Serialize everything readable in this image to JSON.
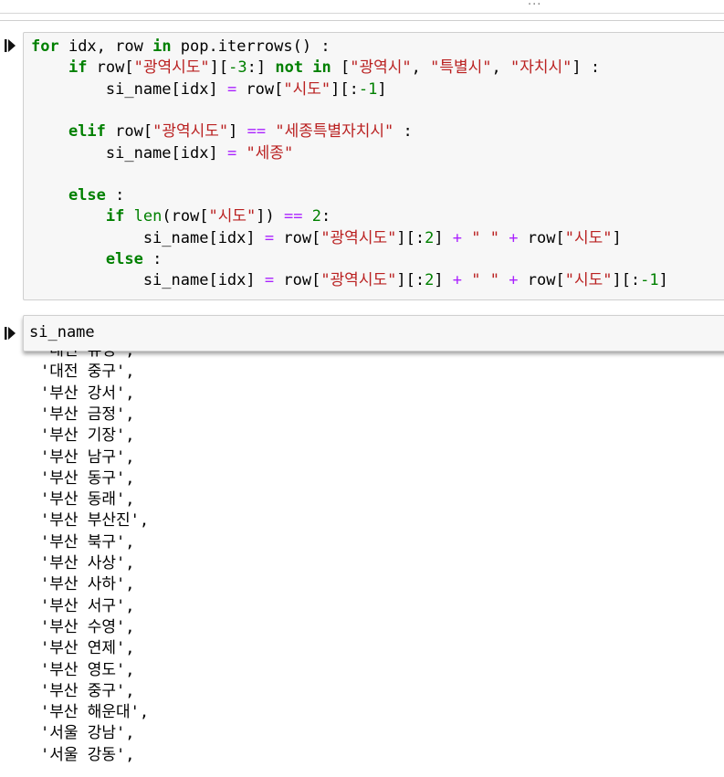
{
  "toolbar": {
    "overflow_dots": "..."
  },
  "code_cell": {
    "lines": [
      [
        {
          "t": "for",
          "c": "kw"
        },
        {
          "t": " idx, row ",
          "c": ""
        },
        {
          "t": "in",
          "c": "kw"
        },
        {
          "t": " pop.iterrows() :",
          "c": ""
        }
      ],
      [
        {
          "t": "    ",
          "c": ""
        },
        {
          "t": "if",
          "c": "kw"
        },
        {
          "t": " row[",
          "c": ""
        },
        {
          "t": "\"광역시도\"",
          "c": "str"
        },
        {
          "t": "][",
          "c": ""
        },
        {
          "t": "-3",
          "c": "num"
        },
        {
          "t": ":] ",
          "c": ""
        },
        {
          "t": "not in",
          "c": "kw"
        },
        {
          "t": " [",
          "c": ""
        },
        {
          "t": "\"광역시\"",
          "c": "str"
        },
        {
          "t": ", ",
          "c": ""
        },
        {
          "t": "\"특별시\"",
          "c": "str"
        },
        {
          "t": ", ",
          "c": ""
        },
        {
          "t": "\"자치시\"",
          "c": "str"
        },
        {
          "t": "] :",
          "c": ""
        }
      ],
      [
        {
          "t": "        si_name[idx] ",
          "c": ""
        },
        {
          "t": "=",
          "c": "op"
        },
        {
          "t": " row[",
          "c": ""
        },
        {
          "t": "\"시도\"",
          "c": "str"
        },
        {
          "t": "][:",
          "c": ""
        },
        {
          "t": "-1",
          "c": "num"
        },
        {
          "t": "]",
          "c": ""
        }
      ],
      [],
      [
        {
          "t": "    ",
          "c": ""
        },
        {
          "t": "elif",
          "c": "kw"
        },
        {
          "t": " row[",
          "c": ""
        },
        {
          "t": "\"광역시도\"",
          "c": "str"
        },
        {
          "t": "] ",
          "c": ""
        },
        {
          "t": "==",
          "c": "op"
        },
        {
          "t": " ",
          "c": ""
        },
        {
          "t": "\"세종특별자치시\"",
          "c": "str"
        },
        {
          "t": " :",
          "c": ""
        }
      ],
      [
        {
          "t": "        si_name[idx] ",
          "c": ""
        },
        {
          "t": "=",
          "c": "op"
        },
        {
          "t": " ",
          "c": ""
        },
        {
          "t": "\"세종\"",
          "c": "str"
        }
      ],
      [],
      [
        {
          "t": "    ",
          "c": ""
        },
        {
          "t": "else",
          "c": "kw"
        },
        {
          "t": " :",
          "c": ""
        }
      ],
      [
        {
          "t": "        ",
          "c": ""
        },
        {
          "t": "if",
          "c": "kw"
        },
        {
          "t": " ",
          "c": ""
        },
        {
          "t": "len",
          "c": "bi"
        },
        {
          "t": "(row[",
          "c": ""
        },
        {
          "t": "\"시도\"",
          "c": "str"
        },
        {
          "t": "]) ",
          "c": ""
        },
        {
          "t": "==",
          "c": "op"
        },
        {
          "t": " ",
          "c": ""
        },
        {
          "t": "2",
          "c": "num"
        },
        {
          "t": ":",
          "c": ""
        }
      ],
      [
        {
          "t": "            si_name[idx] ",
          "c": ""
        },
        {
          "t": "=",
          "c": "op"
        },
        {
          "t": " row[",
          "c": ""
        },
        {
          "t": "\"광역시도\"",
          "c": "str"
        },
        {
          "t": "][:",
          "c": ""
        },
        {
          "t": "2",
          "c": "num"
        },
        {
          "t": "] ",
          "c": ""
        },
        {
          "t": "+",
          "c": "op"
        },
        {
          "t": " ",
          "c": ""
        },
        {
          "t": "\" \"",
          "c": "str"
        },
        {
          "t": " ",
          "c": ""
        },
        {
          "t": "+",
          "c": "op"
        },
        {
          "t": " row[",
          "c": ""
        },
        {
          "t": "\"시도\"",
          "c": "str"
        },
        {
          "t": "]",
          "c": ""
        }
      ],
      [
        {
          "t": "        ",
          "c": ""
        },
        {
          "t": "else",
          "c": "kw"
        },
        {
          "t": " :",
          "c": ""
        }
      ],
      [
        {
          "t": "            si_name[idx] ",
          "c": ""
        },
        {
          "t": "=",
          "c": "op"
        },
        {
          "t": " row[",
          "c": ""
        },
        {
          "t": "\"광역시도\"",
          "c": "str"
        },
        {
          "t": "][:",
          "c": ""
        },
        {
          "t": "2",
          "c": "num"
        },
        {
          "t": "] ",
          "c": ""
        },
        {
          "t": "+",
          "c": "op"
        },
        {
          "t": " ",
          "c": ""
        },
        {
          "t": "\" \"",
          "c": "str"
        },
        {
          "t": " ",
          "c": ""
        },
        {
          "t": "+",
          "c": "op"
        },
        {
          "t": " row[",
          "c": ""
        },
        {
          "t": "\"시도\"",
          "c": "str"
        },
        {
          "t": "][:",
          "c": ""
        },
        {
          "t": "-1",
          "c": "num"
        },
        {
          "t": "]",
          "c": ""
        }
      ]
    ]
  },
  "input_cell": {
    "code": "si_name"
  },
  "output_lines": [
    "'대전 유성',",
    "'대전 중구',",
    "'부산 강서',",
    "'부산 금정',",
    "'부산 기장',",
    "'부산 남구',",
    "'부산 동구',",
    "'부산 동래',",
    "'부산 부산진',",
    "'부산 북구',",
    "'부산 사상',",
    "'부산 사하',",
    "'부산 서구',",
    "'부산 수영',",
    "'부산 연제',",
    "'부산 영도',",
    "'부산 중구',",
    "'부산 해운대',",
    "'서울 강남',",
    "'서울 강동',"
  ]
}
